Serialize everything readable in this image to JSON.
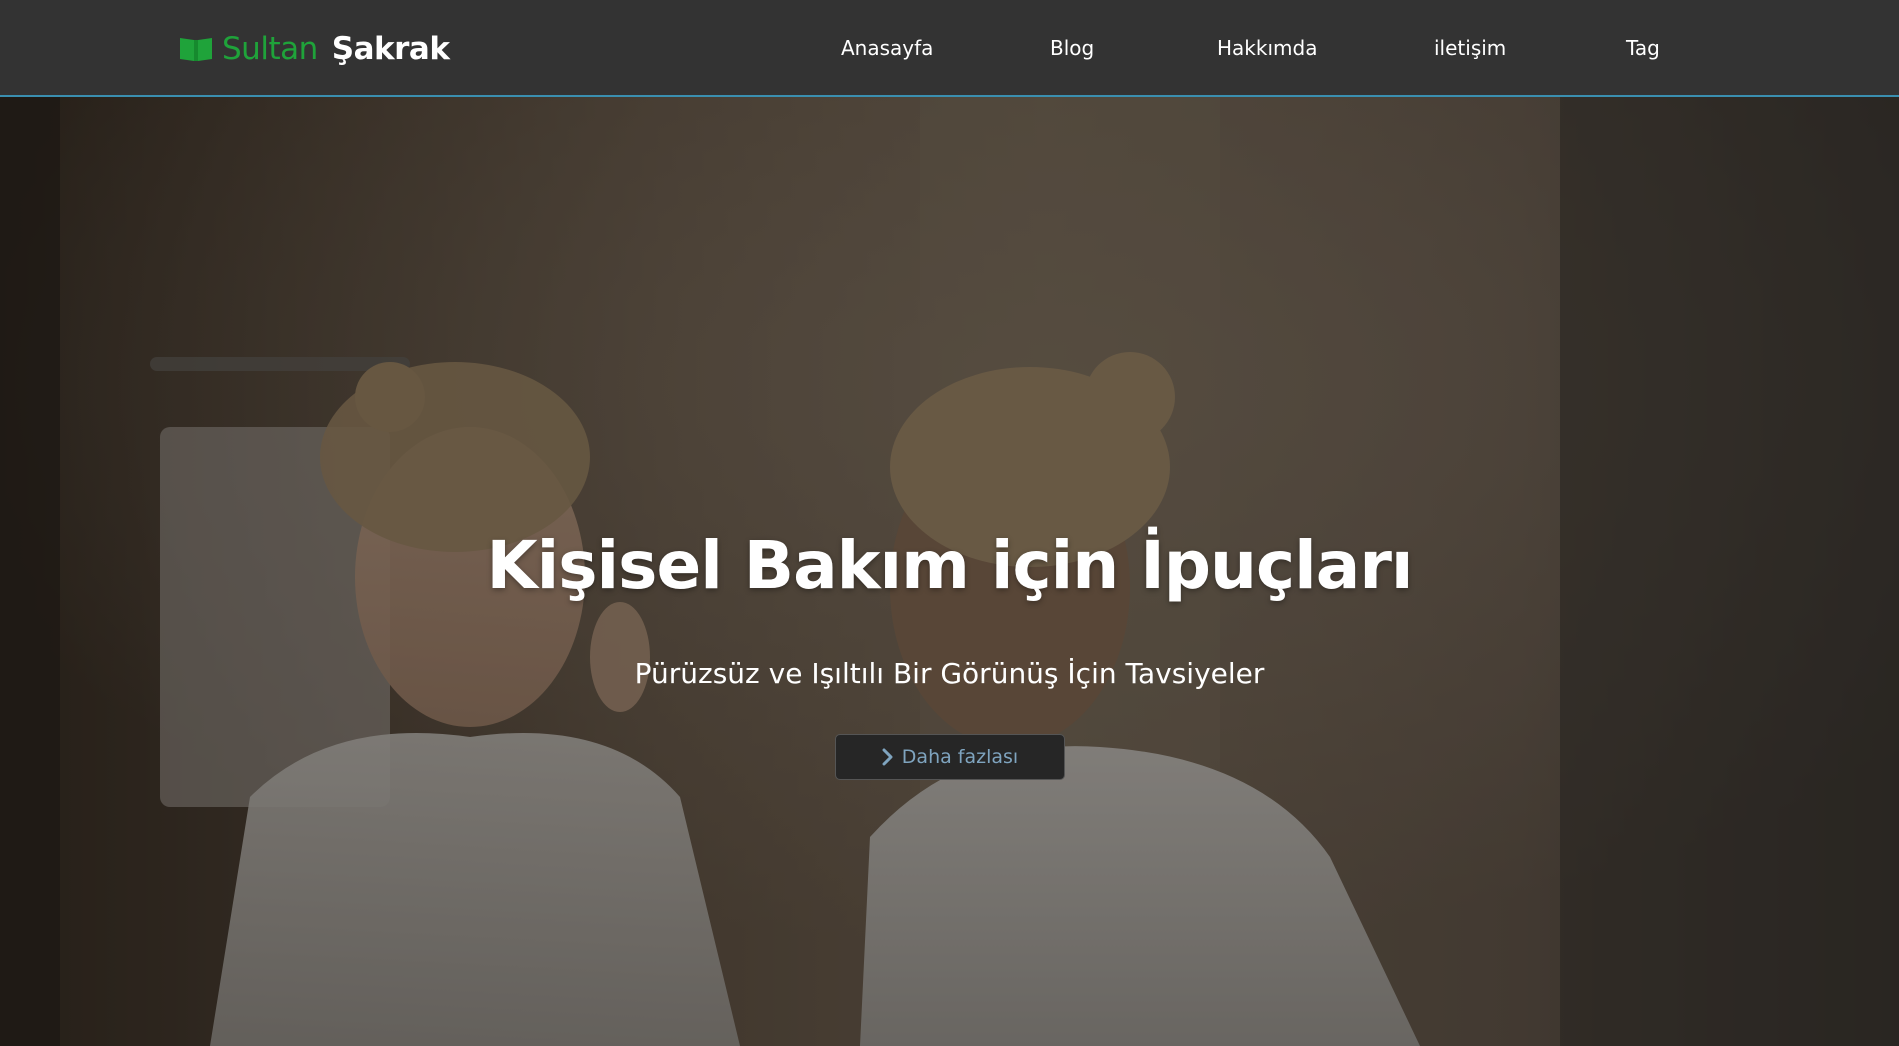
{
  "brand": {
    "first": "Sultan",
    "last": "Şakrak",
    "icon": "open-book-icon",
    "accent_color": "#1fa33a"
  },
  "nav": {
    "items": [
      {
        "label": "Anasayfa"
      },
      {
        "label": "Blog"
      },
      {
        "label": "Hakkımda"
      },
      {
        "label": "iletişim"
      },
      {
        "label": "Tag"
      }
    ],
    "border_color": "#3a8fb0"
  },
  "hero": {
    "title": "Kişisel Bakım için İpuçları",
    "subtitle": "Pürüzsüz ve Işıltılı Bir Görünüş İçin Tavsiyeler",
    "button": {
      "label": "Daha fazlası",
      "icon": "chevron-right-icon"
    }
  }
}
